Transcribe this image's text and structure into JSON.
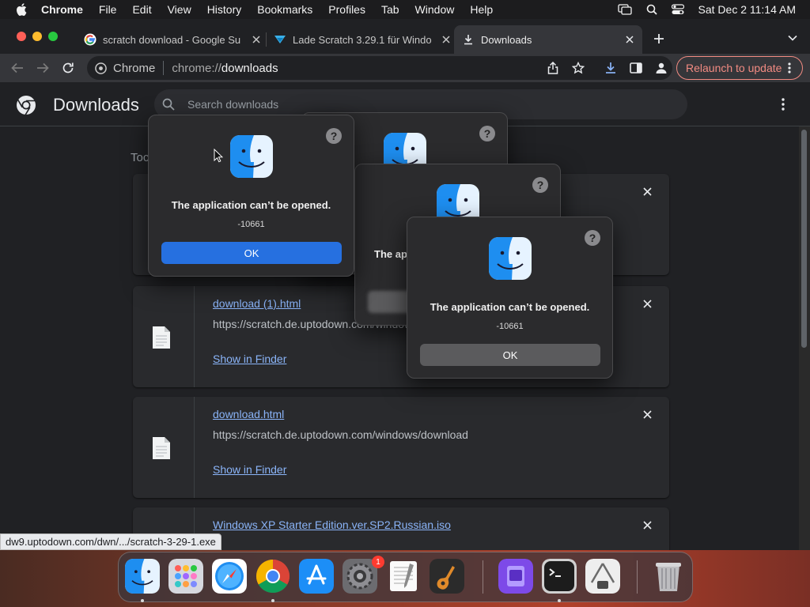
{
  "menubar": {
    "app_name": "Chrome",
    "items": [
      "File",
      "Edit",
      "View",
      "History",
      "Bookmarks",
      "Profiles",
      "Tab",
      "Window",
      "Help"
    ],
    "clock": "Sat Dec 2  11:14 AM"
  },
  "tabs": [
    {
      "title": "scratch download - Google Su",
      "favicon": "google-icon"
    },
    {
      "title": "Lade Scratch 3.29.1 für Windo",
      "favicon": "uptodown-icon"
    },
    {
      "title": "Downloads",
      "favicon": "download-icon",
      "active": true
    }
  ],
  "omnibox": {
    "chip": "Chrome",
    "url_scheme": "chrome://",
    "url_host": "downloads"
  },
  "relaunch_label": "Relaunch to update",
  "page": {
    "title": "Downloads",
    "search_placeholder": "Search downloads",
    "date_heading": "Toc"
  },
  "downloads": [
    {
      "name": "download (1).html",
      "url": "https://scratch.de.uptodown.com/window",
      "action": "Show in Finder"
    },
    {
      "name": "download.html",
      "url": "https://scratch.de.uptodown.com/windows/download",
      "action": "Show in Finder"
    },
    {
      "name": "Windows XP Starter Edition.ver.SP2.Russian.iso",
      "url": "",
      "action": ""
    }
  ],
  "status_url": "dw9.uptodown.com/dwn/.../scratch-3-29-1.exe",
  "alerts": [
    {
      "message": "The application can’t be opened.",
      "code": "-10661",
      "ok_label": "OK"
    },
    {
      "message": "",
      "code": "",
      "ok_label": ""
    },
    {
      "message": "The ap",
      "code": "",
      "ok_label": ""
    },
    {
      "message": "The application can’t be opened.",
      "code": "-10661",
      "ok_label": "OK"
    }
  ],
  "help_glyph": "?",
  "dock": {
    "apps": [
      "Finder",
      "Launchpad",
      "Safari",
      "Google Chrome",
      "App Store",
      "System Settings",
      "TextEdit",
      "GarageBand",
      "Apple Configurator",
      "Terminal",
      "Archive Utility",
      "Trash"
    ],
    "settings_badge": "1"
  },
  "colors": {
    "accent_blue": "#2670e0",
    "link_blue": "#8ab4f8",
    "relaunch_red": "#f28b82"
  }
}
